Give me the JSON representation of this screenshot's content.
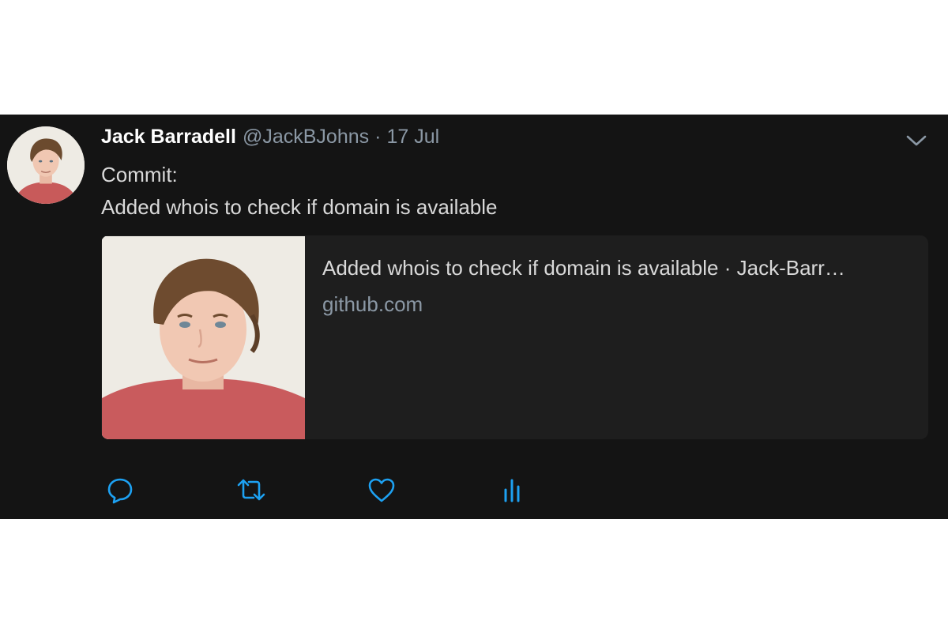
{
  "tweet": {
    "display_name": "Jack Barradell",
    "handle": "@JackBJohns",
    "separator": "·",
    "date": "17 Jul",
    "text_lines": [
      "Commit:",
      "Added whois to check if domain is available"
    ],
    "avatar_icon": "profile-photo"
  },
  "card": {
    "title": "Added whois to check if domain is available · Jack-Barr…",
    "domain": "github.com",
    "image_icon": "profile-photo"
  },
  "actions": [
    {
      "name": "reply",
      "icon": "reply-icon"
    },
    {
      "name": "retweet",
      "icon": "retweet-icon"
    },
    {
      "name": "like",
      "icon": "heart-icon"
    },
    {
      "name": "analytics",
      "icon": "analytics-icon"
    }
  ],
  "colors": {
    "background": "#141414",
    "card_background": "#1e1e1e",
    "name": "#ffffff",
    "secondary": "#8b98a5",
    "body_text": "#d9d9d9",
    "icon_accent": "#1da1f2"
  }
}
